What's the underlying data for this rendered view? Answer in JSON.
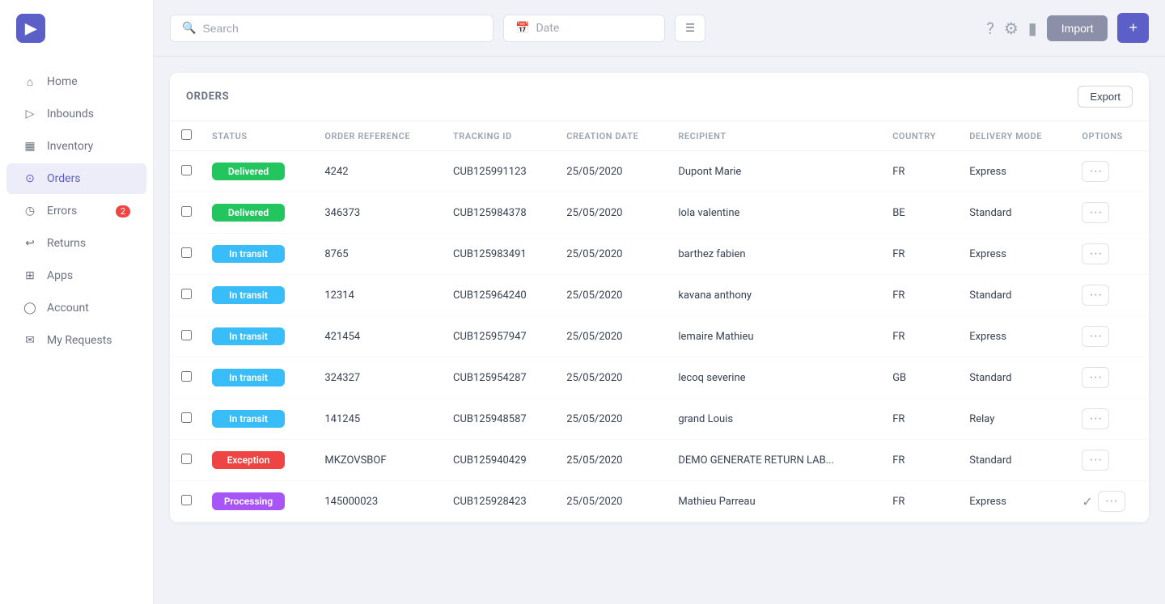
{
  "sidebar": {
    "logo_text": "▶",
    "nav_items": [
      {
        "id": "home",
        "label": "Home",
        "icon": "home",
        "active": false
      },
      {
        "id": "inbounds",
        "label": "Inbounds",
        "icon": "inbounds",
        "active": false
      },
      {
        "id": "inventory",
        "label": "Inventory",
        "icon": "inventory",
        "active": false
      },
      {
        "id": "orders",
        "label": "Orders",
        "icon": "orders",
        "active": true
      },
      {
        "id": "errors",
        "label": "Errors",
        "icon": "errors",
        "active": false,
        "badge": "2"
      },
      {
        "id": "returns",
        "label": "Returns",
        "icon": "returns",
        "active": false
      },
      {
        "id": "apps",
        "label": "Apps",
        "icon": "apps",
        "active": false
      },
      {
        "id": "account",
        "label": "Account",
        "icon": "account",
        "active": false
      },
      {
        "id": "my-requests",
        "label": "My Requests",
        "icon": "requests",
        "active": false
      }
    ]
  },
  "topbar": {
    "search_placeholder": "Search",
    "date_placeholder": "Date",
    "import_label": "Import",
    "add_label": "+"
  },
  "orders": {
    "title": "ORDERS",
    "export_label": "Export",
    "columns": {
      "status": "STATUS",
      "order_ref": "ORDER REFERENCE",
      "tracking_id": "TRACKING ID",
      "creation_date": "CREATION DATE",
      "recipient": "RECIPIENT",
      "country": "COUNTRY",
      "delivery_mode": "DELIVERY MODE",
      "options": "OPTIONS"
    },
    "rows": [
      {
        "id": 1,
        "status": "Delivered",
        "status_type": "delivered",
        "order_ref": "4242",
        "tracking_id": "CUB125991123",
        "creation_date": "25/05/2020",
        "recipient": "Dupont Marie",
        "country": "FR",
        "delivery_mode": "Express",
        "check_icon": false
      },
      {
        "id": 2,
        "status": "Delivered",
        "status_type": "delivered",
        "order_ref": "346373",
        "tracking_id": "CUB125984378",
        "creation_date": "25/05/2020",
        "recipient": "lola valentine",
        "country": "BE",
        "delivery_mode": "Standard",
        "check_icon": false
      },
      {
        "id": 3,
        "status": "In transit",
        "status_type": "in-transit",
        "order_ref": "8765",
        "tracking_id": "CUB125983491",
        "creation_date": "25/05/2020",
        "recipient": "barthez fabien",
        "country": "FR",
        "delivery_mode": "Express",
        "check_icon": false
      },
      {
        "id": 4,
        "status": "In transit",
        "status_type": "in-transit",
        "order_ref": "12314",
        "tracking_id": "CUB125964240",
        "creation_date": "25/05/2020",
        "recipient": "kavana anthony",
        "country": "FR",
        "delivery_mode": "Standard",
        "check_icon": false
      },
      {
        "id": 5,
        "status": "In transit",
        "status_type": "in-transit",
        "order_ref": "421454",
        "tracking_id": "CUB125957947",
        "creation_date": "25/05/2020",
        "recipient": "lemaire Mathieu",
        "country": "FR",
        "delivery_mode": "Express",
        "check_icon": false
      },
      {
        "id": 6,
        "status": "In transit",
        "status_type": "in-transit",
        "order_ref": "324327",
        "tracking_id": "CUB125954287",
        "creation_date": "25/05/2020",
        "recipient": "lecoq severine",
        "country": "GB",
        "delivery_mode": "Standard",
        "check_icon": false
      },
      {
        "id": 7,
        "status": "In transit",
        "status_type": "in-transit",
        "order_ref": "141245",
        "tracking_id": "CUB125948587",
        "creation_date": "25/05/2020",
        "recipient": "grand Louis",
        "country": "FR",
        "delivery_mode": "Relay",
        "check_icon": false
      },
      {
        "id": 8,
        "status": "Exception",
        "status_type": "exception",
        "order_ref": "MKZOVSBOF",
        "tracking_id": "CUB125940429",
        "creation_date": "25/05/2020",
        "recipient": "DEMO GENERATE RETURN LAB...",
        "country": "FR",
        "delivery_mode": "Standard",
        "check_icon": false
      },
      {
        "id": 9,
        "status": "Processing",
        "status_type": "processing",
        "order_ref": "145000023",
        "tracking_id": "CUB125928423",
        "creation_date": "25/05/2020",
        "recipient": "Mathieu Parreau",
        "country": "FR",
        "delivery_mode": "Express",
        "check_icon": true
      }
    ]
  }
}
